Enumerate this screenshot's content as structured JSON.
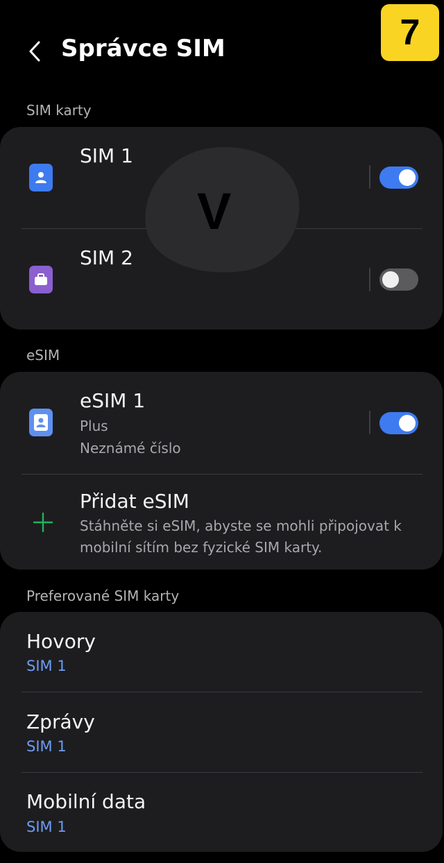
{
  "header": {
    "title": "Správce SIM",
    "step_badge": "7"
  },
  "sections": {
    "sim_cards": "SIM karty",
    "esim": "eSIM",
    "preferred": "Preferované SIM karty"
  },
  "sim_cards": [
    {
      "name": "SIM 1",
      "icon": "person-icon",
      "icon_color": "#3e7bf0",
      "enabled": true
    },
    {
      "name": "SIM 2",
      "icon": "briefcase-icon",
      "icon_color": "#8b5fd0",
      "enabled": false
    }
  ],
  "overlay_letter": "V",
  "esim": {
    "name": "eSIM 1",
    "carrier": "Plus",
    "number": "Neznámé číslo",
    "enabled": true,
    "add": {
      "title": "Přidat eSIM",
      "desc_line1": "Stáhněte si eSIM, abyste se mohli připojovat k",
      "desc_line2": "mobilní sítím bez fyzické SIM karty."
    }
  },
  "preferred": [
    {
      "label": "Hovory",
      "value": "SIM 1"
    },
    {
      "label": "Zprávy",
      "value": "SIM 1"
    },
    {
      "label": "Mobilní data",
      "value": "SIM 1"
    }
  ],
  "colors": {
    "accent": "#3e7bf0",
    "link_blue": "#6e9cf2",
    "add_green": "#1fb35a",
    "badge_yellow": "#f9d423"
  }
}
